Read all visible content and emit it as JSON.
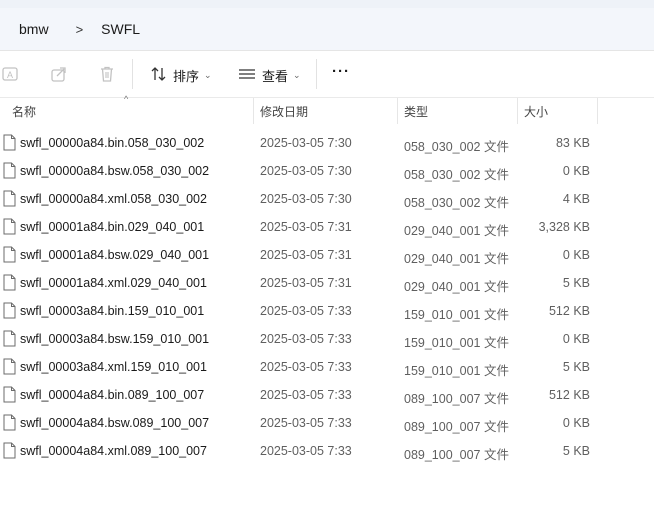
{
  "breadcrumb": {
    "items": [
      "bmw",
      "SWFL"
    ],
    "separator": ">"
  },
  "toolbar": {
    "sort_label": "排序",
    "view_label": "查看",
    "more_label": "···"
  },
  "columns": {
    "name": "名称",
    "date": "修改日期",
    "type": "类型",
    "size": "大小"
  },
  "files": [
    {
      "name": "swfl_00000a84.bin.058_030_002",
      "date": "2025-03-05 7:30",
      "type": "058_030_002 文件",
      "size": "83 KB"
    },
    {
      "name": "swfl_00000a84.bsw.058_030_002",
      "date": "2025-03-05 7:30",
      "type": "058_030_002 文件",
      "size": "0 KB"
    },
    {
      "name": "swfl_00000a84.xml.058_030_002",
      "date": "2025-03-05 7:30",
      "type": "058_030_002 文件",
      "size": "4 KB"
    },
    {
      "name": "swfl_00001a84.bin.029_040_001",
      "date": "2025-03-05 7:31",
      "type": "029_040_001 文件",
      "size": "3,328 KB"
    },
    {
      "name": "swfl_00001a84.bsw.029_040_001",
      "date": "2025-03-05 7:31",
      "type": "029_040_001 文件",
      "size": "0 KB"
    },
    {
      "name": "swfl_00001a84.xml.029_040_001",
      "date": "2025-03-05 7:31",
      "type": "029_040_001 文件",
      "size": "5 KB"
    },
    {
      "name": "swfl_00003a84.bin.159_010_001",
      "date": "2025-03-05 7:33",
      "type": "159_010_001 文件",
      "size": "512 KB"
    },
    {
      "name": "swfl_00003a84.bsw.159_010_001",
      "date": "2025-03-05 7:33",
      "type": "159_010_001 文件",
      "size": "0 KB"
    },
    {
      "name": "swfl_00003a84.xml.159_010_001",
      "date": "2025-03-05 7:33",
      "type": "159_010_001 文件",
      "size": "5 KB"
    },
    {
      "name": "swfl_00004a84.bin.089_100_007",
      "date": "2025-03-05 7:33",
      "type": "089_100_007 文件",
      "size": "512 KB"
    },
    {
      "name": "swfl_00004a84.bsw.089_100_007",
      "date": "2025-03-05 7:33",
      "type": "089_100_007 文件",
      "size": "0 KB"
    },
    {
      "name": "swfl_00004a84.xml.089_100_007",
      "date": "2025-03-05 7:33",
      "type": "089_100_007 文件",
      "size": "5 KB"
    }
  ],
  "colors": {
    "toolbar_bg": "#f3f6fb",
    "text_secondary": "#5f5f5f",
    "disabled_icon": "#c2c2c2"
  },
  "icons": [
    "rename-icon",
    "share-icon",
    "delete-icon",
    "sort-icon",
    "view-icon",
    "more-icon",
    "file-icon",
    "chevron-right-icon",
    "sort-up-icon"
  ]
}
